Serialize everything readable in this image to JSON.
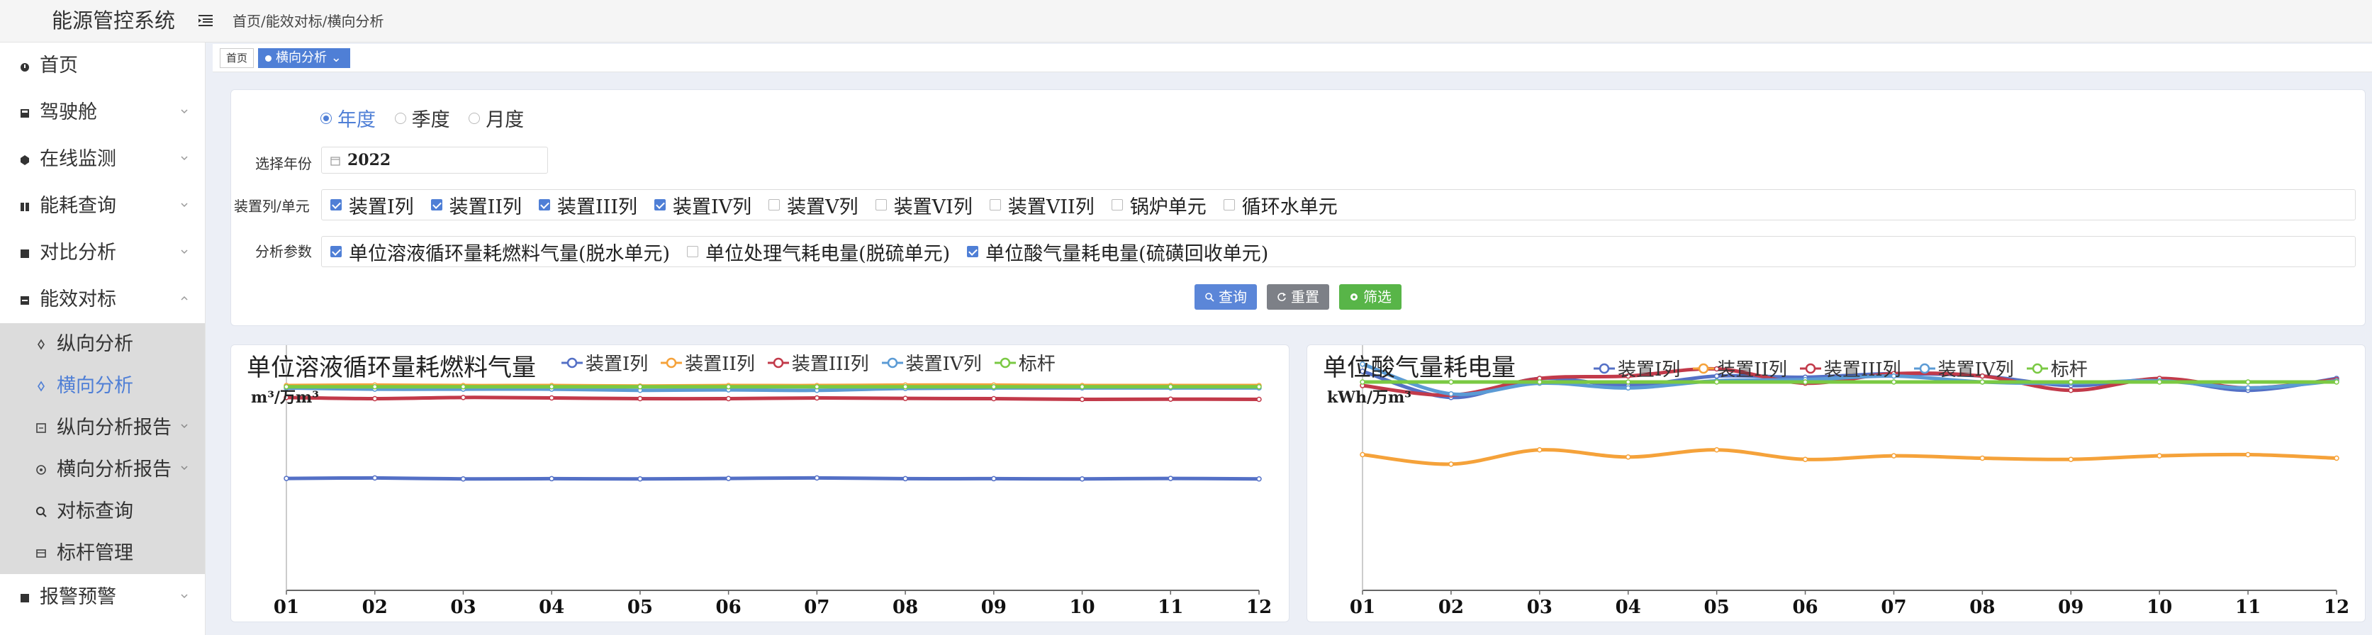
{
  "app": {
    "title": "能源管控系统"
  },
  "breadcrumb": [
    "首页",
    "能效对标",
    "横向分析"
  ],
  "breadcrumb_sep": "/",
  "sidebar": {
    "items": [
      {
        "label": "首页",
        "icon": "dashboard-icon",
        "chevron": ""
      },
      {
        "label": "驾驶舱",
        "icon": "cockpit-icon",
        "chevron": "down"
      },
      {
        "label": "在线监测",
        "icon": "monitor-icon",
        "chevron": "down"
      },
      {
        "label": "能耗查询",
        "icon": "energy-query-icon",
        "chevron": "down"
      },
      {
        "label": "对比分析",
        "icon": "compare-icon",
        "chevron": "down"
      },
      {
        "label": "能效对标",
        "icon": "benchmark-icon",
        "chevron": "up"
      }
    ],
    "submenu": [
      {
        "label": "纵向分析",
        "icon": "vertical-analysis-icon",
        "active": false,
        "chevron": ""
      },
      {
        "label": "横向分析",
        "icon": "horizontal-analysis-icon",
        "active": true,
        "chevron": ""
      },
      {
        "label": "纵向分析报告",
        "icon": "report-icon",
        "active": false,
        "chevron": "down"
      },
      {
        "label": "横向分析报告",
        "icon": "report-icon",
        "active": false,
        "chevron": "down"
      },
      {
        "label": "对标查询",
        "icon": "search-icon",
        "active": false,
        "chevron": ""
      },
      {
        "label": "标杆管理",
        "icon": "benchmark-manage-icon",
        "active": false,
        "chevron": ""
      }
    ],
    "after": {
      "label": "报警预警",
      "icon": "alarm-icon",
      "chevron": "down"
    }
  },
  "tabs": {
    "home": "首页",
    "active": "横向分析"
  },
  "filter": {
    "period_options": [
      {
        "label": "年度",
        "checked": true
      },
      {
        "label": "季度",
        "checked": false
      },
      {
        "label": "月度",
        "checked": false
      }
    ],
    "year_label": "选择年份",
    "year_value": "2022",
    "unit_label": "装置列/单元",
    "units": [
      {
        "label": "装置I列",
        "checked": true
      },
      {
        "label": "装置II列",
        "checked": true
      },
      {
        "label": "装置III列",
        "checked": true
      },
      {
        "label": "装置IV列",
        "checked": true
      },
      {
        "label": "装置V列",
        "checked": false
      },
      {
        "label": "装置VI列",
        "checked": false
      },
      {
        "label": "装置VII列",
        "checked": false
      },
      {
        "label": "锅炉单元",
        "checked": false
      },
      {
        "label": "循环水单元",
        "checked": false
      }
    ],
    "param_label": "分析参数",
    "params": [
      {
        "label": "单位溶液循环量耗燃料气量(脱水单元)",
        "checked": true
      },
      {
        "label": "单位处理气耗电量(脱硫单元)",
        "checked": false
      },
      {
        "label": "单位酸气量耗电量(硫磺回收单元)",
        "checked": true
      }
    ],
    "buttons": {
      "query": "查询",
      "reset": "重置",
      "filter": "筛选"
    }
  },
  "colors": {
    "accent": "#4f7fd6",
    "s1": "#5470c6",
    "s2": "#f5a23a",
    "s3": "#c23a4a",
    "s4": "#5b9bd5",
    "benchmark": "#7ac943"
  },
  "chart_data": [
    {
      "type": "line",
      "title": "单位溶液循环量耗燃料气量",
      "ylabel": "m³/万m³",
      "categories": [
        "01",
        "02",
        "03",
        "04",
        "05",
        "06",
        "07",
        "08",
        "09",
        "10",
        "11",
        "12"
      ],
      "series": [
        {
          "name": "装置I列",
          "values": [
            4.7,
            4.72,
            4.68,
            4.69,
            4.68,
            4.7,
            4.72,
            4.69,
            4.69,
            4.68,
            4.7,
            4.68
          ]
        },
        {
          "name": "装置II列",
          "values": [
            8.6,
            8.62,
            8.6,
            8.6,
            8.58,
            8.6,
            8.6,
            8.62,
            8.62,
            8.6,
            8.6,
            8.6
          ]
        },
        {
          "name": "装置III列",
          "values": [
            8.1,
            8.05,
            8.1,
            8.08,
            8.05,
            8.05,
            8.08,
            8.06,
            8.05,
            8.02,
            8.03,
            8.02
          ]
        },
        {
          "name": "装置IV列",
          "values": [
            8.5,
            8.45,
            8.45,
            8.45,
            8.4,
            8.42,
            8.4,
            8.48,
            8.5,
            8.5,
            8.5,
            8.5
          ]
        },
        {
          "name": "标杆",
          "values": [
            8.55,
            8.55,
            8.55,
            8.55,
            8.55,
            8.55,
            8.55,
            8.55,
            8.55,
            8.55,
            8.55,
            8.55
          ]
        }
      ],
      "ylim": [
        0,
        10
      ]
    },
    {
      "type": "line",
      "title": "单位酸气量耗电量",
      "ylabel": "kWh/万m³",
      "categories": [
        "01",
        "02",
        "03",
        "04",
        "05",
        "06",
        "07",
        "08",
        "09",
        "10",
        "11",
        "12"
      ],
      "series": [
        {
          "name": "装置I列",
          "values": [
            9.2,
            8.1,
            8.9,
            8.6,
            9.0,
            8.95,
            9.1,
            9.0,
            8.6,
            8.85,
            8.4,
            8.9
          ]
        },
        {
          "name": "装置II列",
          "values": [
            5.7,
            5.3,
            5.9,
            5.6,
            5.9,
            5.5,
            5.65,
            5.55,
            5.5,
            5.65,
            5.7,
            5.55
          ]
        },
        {
          "name": "装置III列",
          "values": [
            8.6,
            8.2,
            8.9,
            9.0,
            9.3,
            8.7,
            9.1,
            9.0,
            8.4,
            8.9,
            8.5,
            8.85
          ]
        },
        {
          "name": "装置IV列",
          "values": [
            9.5,
            8.25,
            8.7,
            8.5,
            8.8,
            8.85,
            9.0,
            8.75,
            8.7,
            8.8,
            8.5,
            8.8
          ]
        },
        {
          "name": "标杆",
          "values": [
            8.75,
            8.75,
            8.75,
            8.75,
            8.75,
            8.75,
            8.75,
            8.75,
            8.75,
            8.75,
            8.75,
            8.75
          ]
        }
      ],
      "ylim": [
        0,
        10
      ]
    }
  ]
}
